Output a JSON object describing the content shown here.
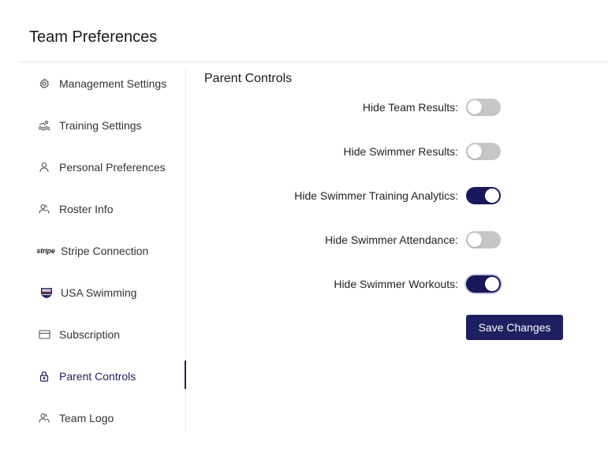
{
  "page": {
    "title": "Team Preferences"
  },
  "colors": {
    "accent": "#1d2060",
    "toggle_off": "#c6c6c6",
    "toggle_on": "#17195a"
  },
  "sidebar": {
    "items": [
      {
        "label": "Management Settings",
        "icon": "gear-icon",
        "active": false
      },
      {
        "label": "Training Settings",
        "icon": "swimmer-icon",
        "active": false
      },
      {
        "label": "Personal Preferences",
        "icon": "user-icon",
        "active": false
      },
      {
        "label": "Roster Info",
        "icon": "users-icon",
        "active": false
      },
      {
        "label": "Stripe Connection",
        "icon": "stripe-logo-icon",
        "icon_text": "stripe",
        "active": false
      },
      {
        "label": "USA Swimming",
        "icon": "usa-swimming-logo-icon",
        "active": false
      },
      {
        "label": "Subscription",
        "icon": "card-icon",
        "active": false
      },
      {
        "label": "Parent Controls",
        "icon": "lock-icon",
        "active": true
      },
      {
        "label": "Team Logo",
        "icon": "users-icon",
        "active": false
      }
    ]
  },
  "parent_controls": {
    "title": "Parent Controls",
    "toggles": [
      {
        "label": "Hide Team Results",
        "separator": ":",
        "on": false
      },
      {
        "label": "Hide Swimmer Results",
        "separator": ":",
        "on": false
      },
      {
        "label": "Hide Swimmer Training Analytics",
        "separator": ":",
        "on": true
      },
      {
        "label": "Hide Swimmer Attendance",
        "separator": ":",
        "on": false
      },
      {
        "label": "Hide Swimmer Workouts",
        "separator": ":",
        "on": true
      }
    ],
    "save_label": "Save Changes"
  }
}
